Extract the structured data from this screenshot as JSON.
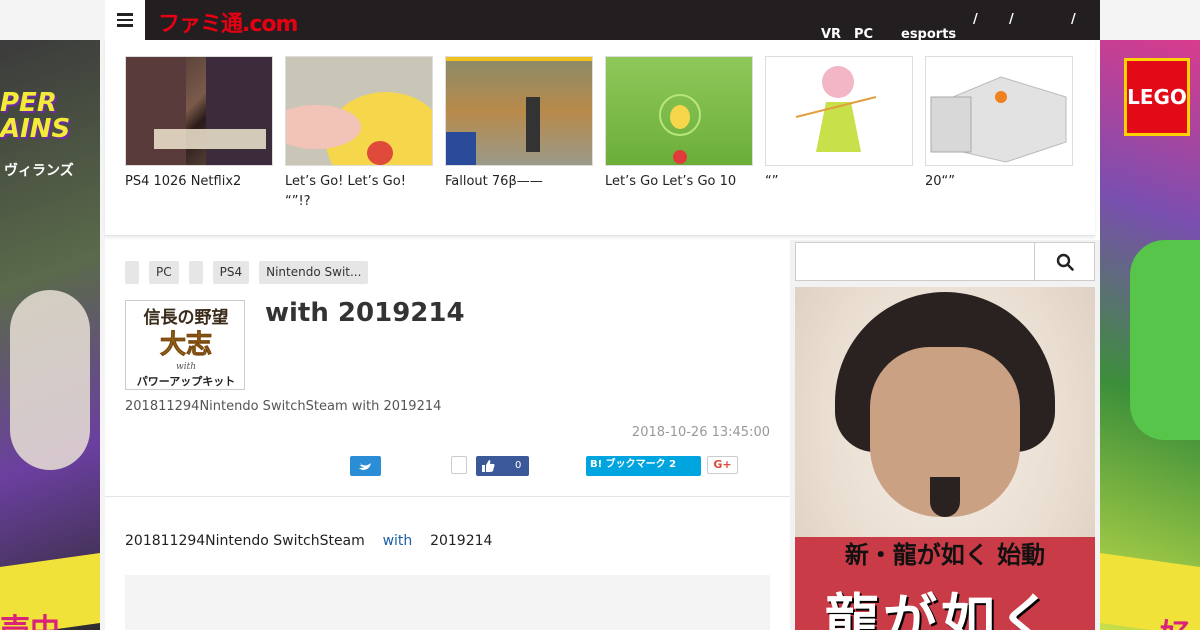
{
  "skins": {
    "left": {
      "headline": "PER\nAINS",
      "subline": "ヴィランズ",
      "bottom": "売中"
    },
    "right": {
      "brand": "LEGO",
      "bottom": "好"
    }
  },
  "header": {
    "logo": "ファミ通.com",
    "menu_icon": "hamburger-icon",
    "nav": [
      "VR",
      "PC",
      "esports",
      "/",
      "/",
      "/"
    ]
  },
  "carousel": [
    {
      "title": "PS4 1026 Netflix2"
    },
    {
      "title": " Let’s Go! Let’s Go!  “”!?"
    },
    {
      "title": "Fallout 76β——"
    },
    {
      "title": " Let’s Go Let’s Go  10"
    },
    {
      "title": "“”"
    },
    {
      "title": "20“”"
    }
  ],
  "article": {
    "tags": [
      "",
      "PC",
      "",
      "PS4",
      "Nintendo Swit..."
    ],
    "boxart_lines": [
      "信長の野望",
      "大志",
      "with",
      "パワーアップキット"
    ],
    "title": " with 2019214",
    "summary": "201811294Nintendo SwitchSteam with  2019214",
    "date": "2018-10-26 13:45:00",
    "share": {
      "twitter_icon": "twitter-icon",
      "fb_count": "0",
      "hatena_label": "B! ブックマーク 2",
      "gplus_label": "G+"
    },
    "body": {
      "before": "201811294Nintendo SwitchSteam    ",
      "link": "with",
      "after": "    2019214"
    }
  },
  "sidebar": {
    "search_placeholder": "",
    "search_icon": "search-icon",
    "ad": {
      "copy1": "新・龍が如く 始動",
      "copy2": "龍が如く"
    }
  },
  "colors": {
    "topbar": "#231f20",
    "logo": "#e60012",
    "twitter": "#2b8dd6",
    "facebook": "#3b5998",
    "hatena": "#00a4de"
  }
}
